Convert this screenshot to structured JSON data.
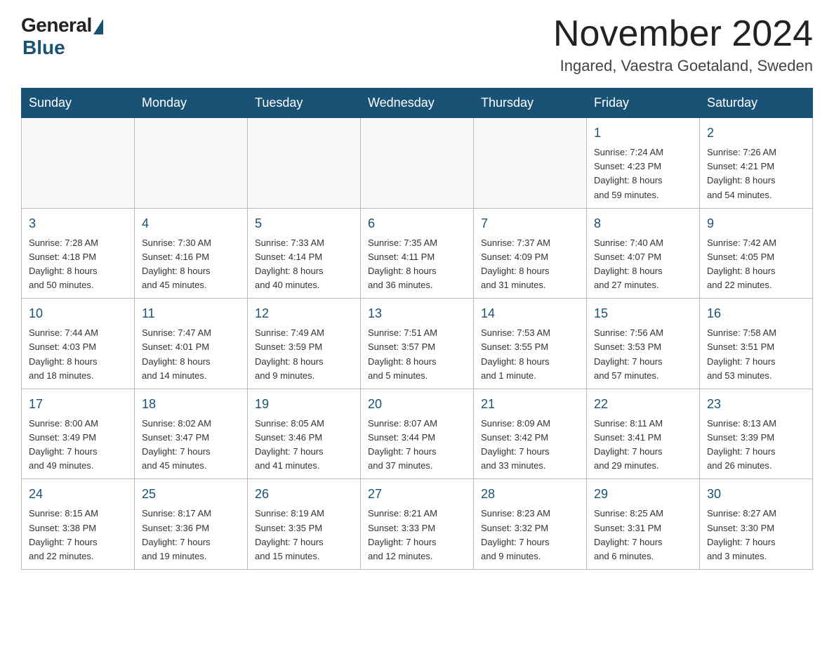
{
  "header": {
    "logo_general": "General",
    "logo_blue": "Blue",
    "month_year": "November 2024",
    "location": "Ingared, Vaestra Goetaland, Sweden"
  },
  "weekdays": [
    "Sunday",
    "Monday",
    "Tuesday",
    "Wednesday",
    "Thursday",
    "Friday",
    "Saturday"
  ],
  "weeks": [
    [
      {
        "day": "",
        "info": ""
      },
      {
        "day": "",
        "info": ""
      },
      {
        "day": "",
        "info": ""
      },
      {
        "day": "",
        "info": ""
      },
      {
        "day": "",
        "info": ""
      },
      {
        "day": "1",
        "info": "Sunrise: 7:24 AM\nSunset: 4:23 PM\nDaylight: 8 hours\nand 59 minutes."
      },
      {
        "day": "2",
        "info": "Sunrise: 7:26 AM\nSunset: 4:21 PM\nDaylight: 8 hours\nand 54 minutes."
      }
    ],
    [
      {
        "day": "3",
        "info": "Sunrise: 7:28 AM\nSunset: 4:18 PM\nDaylight: 8 hours\nand 50 minutes."
      },
      {
        "day": "4",
        "info": "Sunrise: 7:30 AM\nSunset: 4:16 PM\nDaylight: 8 hours\nand 45 minutes."
      },
      {
        "day": "5",
        "info": "Sunrise: 7:33 AM\nSunset: 4:14 PM\nDaylight: 8 hours\nand 40 minutes."
      },
      {
        "day": "6",
        "info": "Sunrise: 7:35 AM\nSunset: 4:11 PM\nDaylight: 8 hours\nand 36 minutes."
      },
      {
        "day": "7",
        "info": "Sunrise: 7:37 AM\nSunset: 4:09 PM\nDaylight: 8 hours\nand 31 minutes."
      },
      {
        "day": "8",
        "info": "Sunrise: 7:40 AM\nSunset: 4:07 PM\nDaylight: 8 hours\nand 27 minutes."
      },
      {
        "day": "9",
        "info": "Sunrise: 7:42 AM\nSunset: 4:05 PM\nDaylight: 8 hours\nand 22 minutes."
      }
    ],
    [
      {
        "day": "10",
        "info": "Sunrise: 7:44 AM\nSunset: 4:03 PM\nDaylight: 8 hours\nand 18 minutes."
      },
      {
        "day": "11",
        "info": "Sunrise: 7:47 AM\nSunset: 4:01 PM\nDaylight: 8 hours\nand 14 minutes."
      },
      {
        "day": "12",
        "info": "Sunrise: 7:49 AM\nSunset: 3:59 PM\nDaylight: 8 hours\nand 9 minutes."
      },
      {
        "day": "13",
        "info": "Sunrise: 7:51 AM\nSunset: 3:57 PM\nDaylight: 8 hours\nand 5 minutes."
      },
      {
        "day": "14",
        "info": "Sunrise: 7:53 AM\nSunset: 3:55 PM\nDaylight: 8 hours\nand 1 minute."
      },
      {
        "day": "15",
        "info": "Sunrise: 7:56 AM\nSunset: 3:53 PM\nDaylight: 7 hours\nand 57 minutes."
      },
      {
        "day": "16",
        "info": "Sunrise: 7:58 AM\nSunset: 3:51 PM\nDaylight: 7 hours\nand 53 minutes."
      }
    ],
    [
      {
        "day": "17",
        "info": "Sunrise: 8:00 AM\nSunset: 3:49 PM\nDaylight: 7 hours\nand 49 minutes."
      },
      {
        "day": "18",
        "info": "Sunrise: 8:02 AM\nSunset: 3:47 PM\nDaylight: 7 hours\nand 45 minutes."
      },
      {
        "day": "19",
        "info": "Sunrise: 8:05 AM\nSunset: 3:46 PM\nDaylight: 7 hours\nand 41 minutes."
      },
      {
        "day": "20",
        "info": "Sunrise: 8:07 AM\nSunset: 3:44 PM\nDaylight: 7 hours\nand 37 minutes."
      },
      {
        "day": "21",
        "info": "Sunrise: 8:09 AM\nSunset: 3:42 PM\nDaylight: 7 hours\nand 33 minutes."
      },
      {
        "day": "22",
        "info": "Sunrise: 8:11 AM\nSunset: 3:41 PM\nDaylight: 7 hours\nand 29 minutes."
      },
      {
        "day": "23",
        "info": "Sunrise: 8:13 AM\nSunset: 3:39 PM\nDaylight: 7 hours\nand 26 minutes."
      }
    ],
    [
      {
        "day": "24",
        "info": "Sunrise: 8:15 AM\nSunset: 3:38 PM\nDaylight: 7 hours\nand 22 minutes."
      },
      {
        "day": "25",
        "info": "Sunrise: 8:17 AM\nSunset: 3:36 PM\nDaylight: 7 hours\nand 19 minutes."
      },
      {
        "day": "26",
        "info": "Sunrise: 8:19 AM\nSunset: 3:35 PM\nDaylight: 7 hours\nand 15 minutes."
      },
      {
        "day": "27",
        "info": "Sunrise: 8:21 AM\nSunset: 3:33 PM\nDaylight: 7 hours\nand 12 minutes."
      },
      {
        "day": "28",
        "info": "Sunrise: 8:23 AM\nSunset: 3:32 PM\nDaylight: 7 hours\nand 9 minutes."
      },
      {
        "day": "29",
        "info": "Sunrise: 8:25 AM\nSunset: 3:31 PM\nDaylight: 7 hours\nand 6 minutes."
      },
      {
        "day": "30",
        "info": "Sunrise: 8:27 AM\nSunset: 3:30 PM\nDaylight: 7 hours\nand 3 minutes."
      }
    ]
  ]
}
